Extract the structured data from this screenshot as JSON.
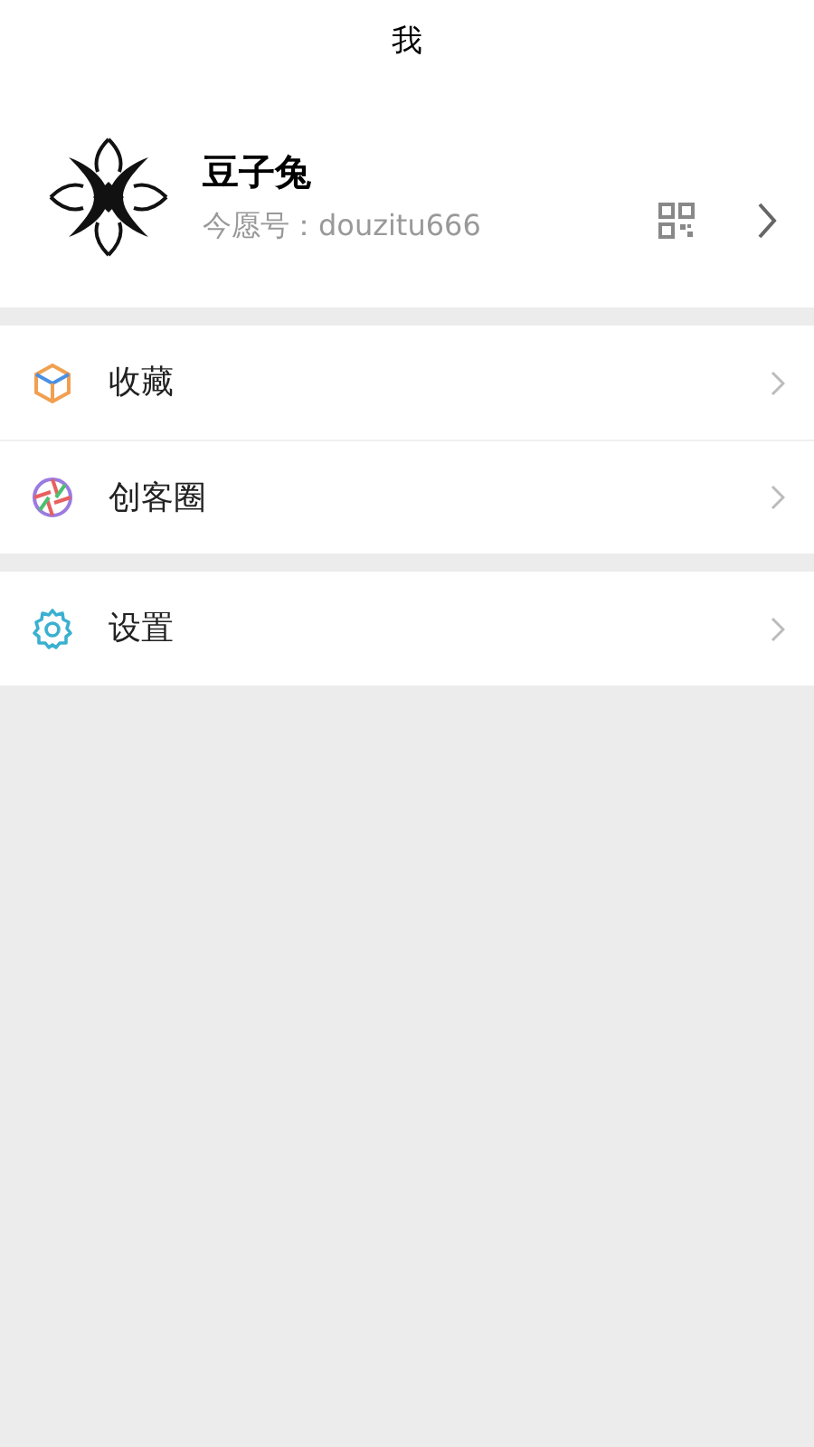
{
  "header": {
    "title": "我"
  },
  "profile": {
    "name": "豆子兔",
    "account": "今愿号：douzitu666"
  },
  "menu_groups": [
    [
      {
        "kind": "box",
        "label": "收藏"
      },
      {
        "kind": "aperture",
        "label": "创客圈"
      }
    ],
    [
      {
        "kind": "gear",
        "label": "设置"
      }
    ]
  ]
}
